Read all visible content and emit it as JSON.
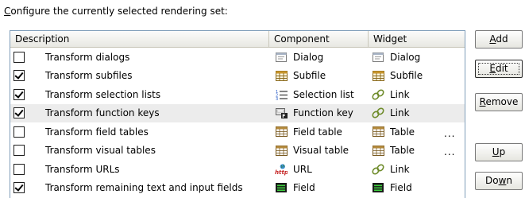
{
  "title_prefix": "C",
  "title_rest": "onfigure the currently selected rendering set:",
  "headers": [
    "Description",
    "Component",
    "Widget"
  ],
  "rows": [
    {
      "checked": false,
      "description": "Transform dialogs",
      "component": "Dialog",
      "component_icon": "dialog-icon",
      "widget": "Dialog",
      "widget_icon": "dialog-icon",
      "dots": ""
    },
    {
      "checked": true,
      "description": "Transform subfiles",
      "component": "Subfile",
      "component_icon": "subfile-icon",
      "widget": "Subfile",
      "widget_icon": "subfile-icon",
      "dots": ""
    },
    {
      "checked": true,
      "description": "Transform selection lists",
      "component": "Selection list",
      "component_icon": "selection-list-icon",
      "widget": "Link",
      "widget_icon": "link-icon",
      "dots": ""
    },
    {
      "checked": true,
      "description": "Transform function keys",
      "component": "Function key",
      "component_icon": "function-key-icon",
      "widget": "Link",
      "widget_icon": "link-icon",
      "dots": ""
    },
    {
      "checked": false,
      "description": "Transform field tables",
      "component": "Field table",
      "component_icon": "table-icon",
      "widget": "Table",
      "widget_icon": "table-icon",
      "dots": "..."
    },
    {
      "checked": false,
      "description": "Transform visual tables",
      "component": "Visual table",
      "component_icon": "table-icon",
      "widget": "Table",
      "widget_icon": "table-icon",
      "dots": "..."
    },
    {
      "checked": false,
      "description": "Transform URLs",
      "component": "URL",
      "component_icon": "url-icon",
      "widget": "Link",
      "widget_icon": "link-icon",
      "dots": ""
    },
    {
      "checked": true,
      "description": "Transform remaining text and input fields",
      "component": "Field",
      "component_icon": "field-icon",
      "widget": "Field",
      "widget_icon": "field-icon",
      "dots": ""
    }
  ],
  "selected_row": 3,
  "buttons": {
    "add": {
      "mnemonic": "A",
      "rest": "dd"
    },
    "edit": {
      "mnemonic": "E",
      "rest": "dit"
    },
    "remove": {
      "mnemonic": "R",
      "rest": "emove"
    },
    "up": {
      "mnemonic": "U",
      "rest": "p"
    },
    "down": {
      "prefix": "Do",
      "mnemonic": "w",
      "rest": "n"
    }
  }
}
